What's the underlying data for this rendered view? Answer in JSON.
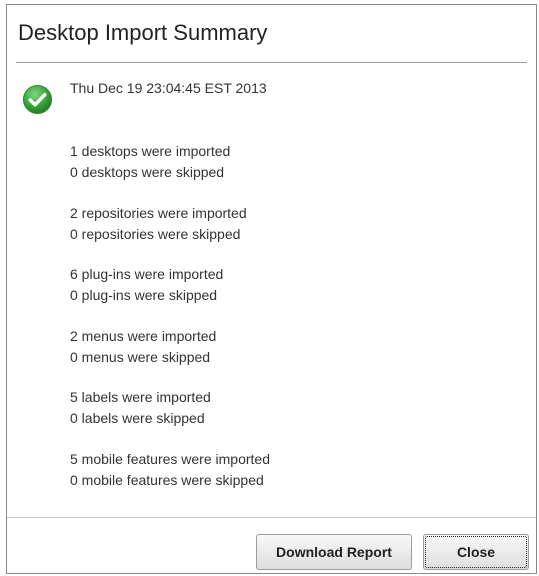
{
  "dialog": {
    "title": "Desktop Import Summary",
    "status_icon": "check-circle-icon",
    "status_color": "#3aa43a",
    "timestamp": "Thu Dec 19 23:04:45 EST 2013",
    "summary": [
      {
        "imported": "1 desktops were imported",
        "skipped": "0 desktops were skipped"
      },
      {
        "imported": "2 repositories were imported",
        "skipped": "0 repositories were skipped"
      },
      {
        "imported": "6 plug-ins were imported",
        "skipped": "0 plug-ins were skipped"
      },
      {
        "imported": "2 menus were imported",
        "skipped": "0 menus were skipped"
      },
      {
        "imported": "5 labels were imported",
        "skipped": "0 labels were skipped"
      },
      {
        "imported": "5 mobile features were imported",
        "skipped": "0 mobile features were skipped"
      }
    ]
  },
  "footer": {
    "download_label": "Download Report",
    "close_label": "Close"
  }
}
